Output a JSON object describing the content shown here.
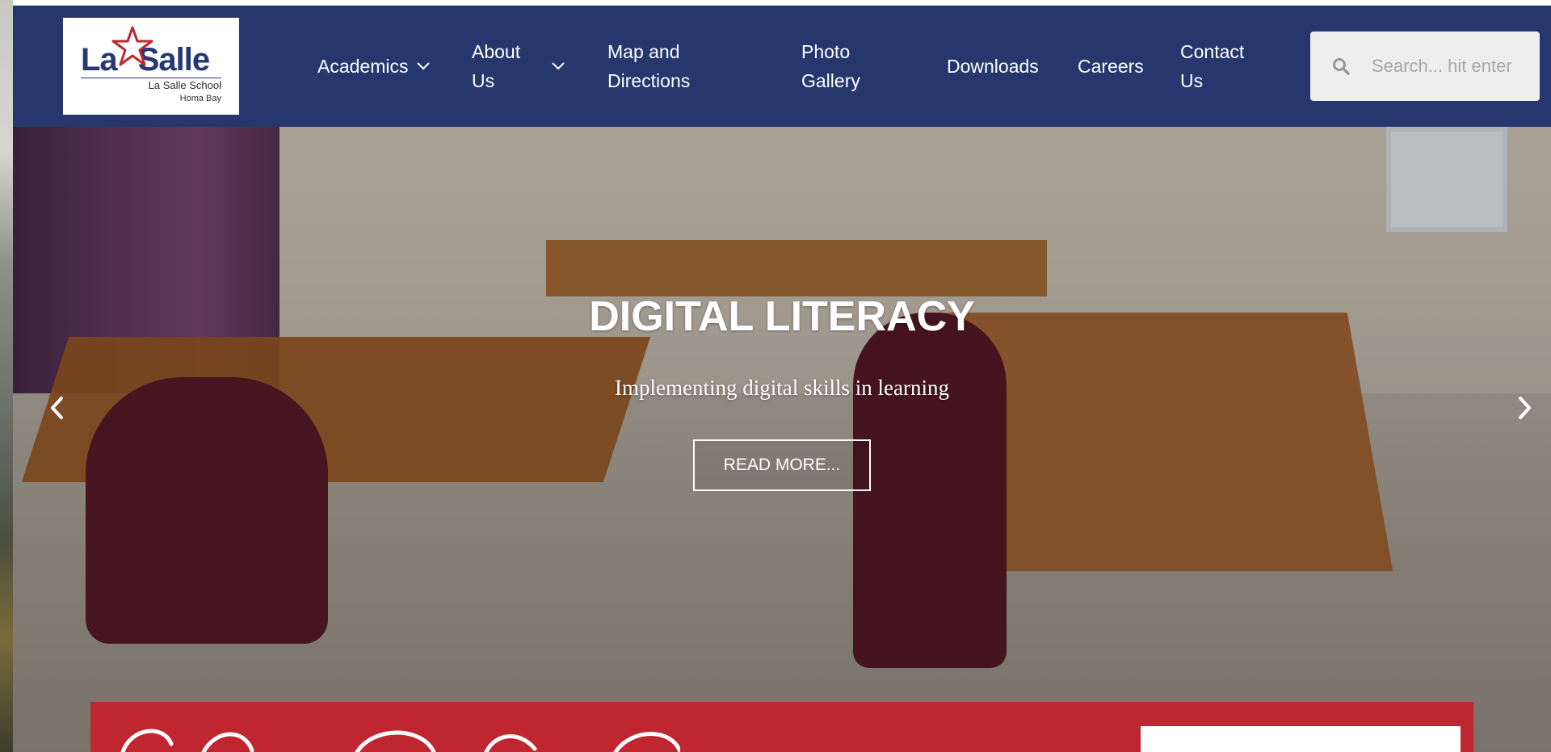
{
  "header": {
    "logo": {
      "wordmark_left": "La",
      "wordmark_right": "Salle",
      "subtitle": "La Salle School",
      "location": "Homa Bay"
    },
    "nav": [
      {
        "label": "Academics",
        "has_dropdown": true
      },
      {
        "label": "About\nUs",
        "has_dropdown": true
      },
      {
        "label": "Map and\nDirections",
        "has_dropdown": false
      },
      {
        "label": "Photo\nGallery",
        "has_dropdown": false
      },
      {
        "label": "Downloads",
        "has_dropdown": false
      },
      {
        "label": "Careers",
        "has_dropdown": false
      },
      {
        "label": "Contact\nUs",
        "has_dropdown": false
      }
    ],
    "search": {
      "placeholder": "Search... hit enter",
      "value": ""
    }
  },
  "hero": {
    "title": "DIGITAL LITERACY",
    "subtitle": "Implementing digital skills in learning",
    "button_label": "READ MORE...",
    "prev_icon": "chevron-left-icon",
    "next_icon": "chevron-right-icon"
  },
  "colors": {
    "header_bg": "#26376e",
    "banner_red": "#c0262f",
    "search_bg": "#eeeeee",
    "logo_star": "#c0262f"
  }
}
